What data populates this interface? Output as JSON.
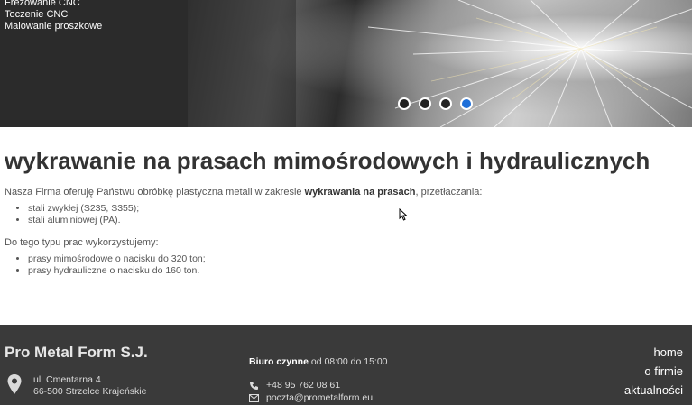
{
  "side_menu": {
    "items": [
      "Frezowanie CNC",
      "Toczenie CNC",
      "Malowanie proszkowe"
    ]
  },
  "slider": {
    "total_slides": 4,
    "active_slide": 4,
    "accent_color": "#1e6fd9"
  },
  "article": {
    "title": "wykrawanie na prasach mimośrodowych i hydraulicznych",
    "intro_prefix": "Nasza Firma oferuję Państwu obróbkę plastyczna metali w zakresie ",
    "intro_bold": "wykrawania na prasach",
    "intro_suffix": ", przetłaczania:",
    "materials": [
      "stali zwykłej (S235, S355);",
      "stali aluminiowej (PA)."
    ],
    "equipment_intro": "Do tego typu prac wykorzystujemy:",
    "equipment": [
      "prasy mimośrodowe o nacisku do 320 ton;",
      "prasy hydrauliczne o nacisku do 160 ton."
    ]
  },
  "footer": {
    "brand": "Pro Metal Form S.J.",
    "address_line1": "ul. Cmentarna 4",
    "address_line2": "66-500 Strzelce Krajeńskie",
    "hours_label": "Biuro czynne",
    "hours_value": " od 08:00 do 15:00",
    "phone": "+48 95 762 08 61",
    "email": "poczta@prometalform.eu",
    "nav": [
      "home",
      "o firmie",
      "aktualności"
    ]
  }
}
